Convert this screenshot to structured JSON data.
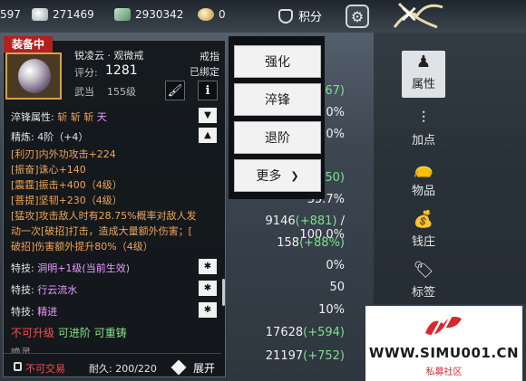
{
  "topbar": {
    "res_partial": "597",
    "silver": "271469",
    "jade": "2930342",
    "gold": "0",
    "jifen_label": "积分"
  },
  "background_stats": [
    {
      "text": "67)",
      "green": true
    },
    {
      "text": "0%",
      "green": false
    },
    {
      "text": "0%",
      "green": false
    },
    {
      "text": "50)",
      "green": true
    },
    {
      "text": "35.7%",
      "green": false
    },
    {
      "text": "9146",
      "extra": "(+881)",
      "tail": " / 100.0%"
    },
    {
      "text": "158",
      "extra": "(+88%)",
      "tail": ""
    },
    {
      "text": "0%",
      "green": false
    },
    {
      "text": "50",
      "green": false
    },
    {
      "text": "10%",
      "green": false
    },
    {
      "text": "17628",
      "extra": "(+594)",
      "tail": ""
    },
    {
      "text": "21197",
      "extra": "(+752)",
      "tail": ""
    }
  ],
  "sidenav": {
    "items": [
      {
        "label": "属性",
        "icon": "character-icon",
        "active": true
      },
      {
        "label": "加点",
        "icon": "sliders-icon",
        "active": false
      },
      {
        "label": "物品",
        "icon": "bag-icon",
        "active": false
      },
      {
        "label": "钱庄",
        "icon": "money-bag-icon",
        "active": false
      },
      {
        "label": "标签",
        "icon": "tag-icon",
        "active": false
      }
    ]
  },
  "item": {
    "equip_tag": "装备中",
    "name": "锐凌云 · 观微戒",
    "type": "戒指",
    "score_label": "评分:",
    "score": "1281",
    "bound": "已绑定",
    "category": "武当",
    "level": "155级"
  },
  "details": {
    "quench_label": "淬锋属性:",
    "quench_values": [
      "斩",
      "斩",
      "斩",
      "天"
    ],
    "refine": "精炼: 4阶（+4）",
    "stats": [
      {
        "tag": "[利刃]",
        "text": "内外功攻击+224",
        "suffix": ""
      },
      {
        "tag": "[振奋]",
        "text": "诛心+140",
        "suffix": ""
      },
      {
        "tag": "[震霆]",
        "text": "振击+400",
        "suffix": "（4级）"
      },
      {
        "tag": "[菩提]",
        "text": "坚韧+230",
        "suffix": "（4级）"
      }
    ],
    "fierce_1": "[猛攻]攻击敌人时有28.75%概率对敌人发",
    "fierce_2": "动一次[破招]打击，造成大量额外伤害；[",
    "fierce_3": "破招]伤害额外提升80%（4级）",
    "skills": [
      {
        "label": "特技:",
        "name": "洞明+1级(当前生效)",
        "color": "violet"
      },
      {
        "label": "特技:",
        "name": "行云流水",
        "color": "violet"
      },
      {
        "label": "特技:",
        "name": "精进",
        "color": "violet"
      }
    ],
    "status_cannot_upgrade": "不可升级",
    "status_can_advance": "可进阶",
    "status_can_recast": "可重铸",
    "partial_bottom": "唤灵",
    "no_trade": "不可交易",
    "durability": "耐久:  200/220",
    "expand": "展开"
  },
  "actions": {
    "strengthen": "强化",
    "quench": "淬锋",
    "downgrade": "退阶",
    "more": "更多"
  },
  "watermark": {
    "site": "WWW.SIMU001.CN",
    "sub": "私募社区"
  }
}
